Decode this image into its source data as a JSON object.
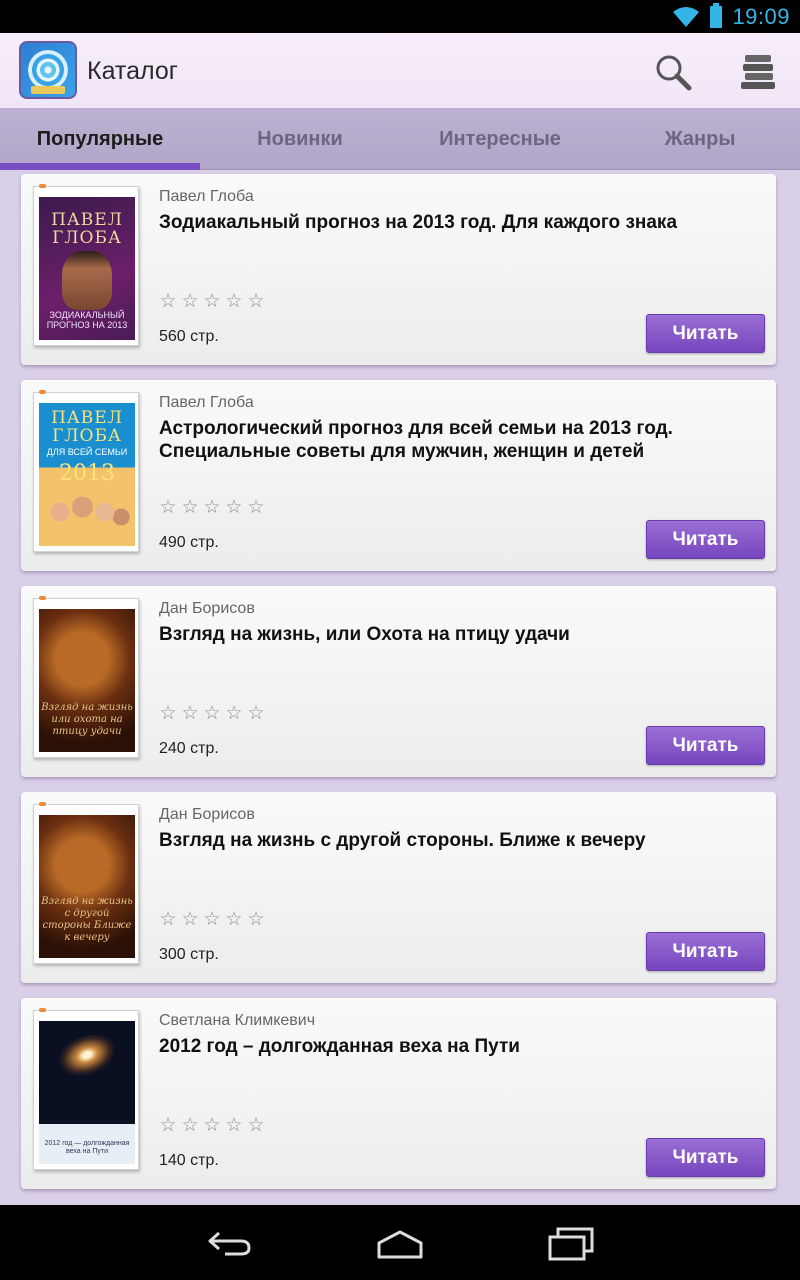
{
  "status_bar": {
    "time": "19:09"
  },
  "action_bar": {
    "title": "Каталог"
  },
  "tabs": [
    {
      "label": "Популярные",
      "active": true
    },
    {
      "label": "Новинки",
      "active": false
    },
    {
      "label": "Интересные",
      "active": false
    },
    {
      "label": "Жанры",
      "active": false
    }
  ],
  "books": [
    {
      "author": "Павел Глоба",
      "title": "Зодиакальный прогноз на 2013 год. Для каждого знака",
      "pages": "560 стр.",
      "rating": 0,
      "button": "Читать",
      "cover": {
        "line1": "ПАВЕЛ",
        "line2": "ГЛОБА",
        "sub": "ЗОДИАКАЛЬНЫЙ ПРОГНОЗ НА 2013"
      }
    },
    {
      "author": "Павел Глоба",
      "title": "Астрологический прогноз для всей семьи на 2013 год. Специальные советы для мужчин, женщин и детей",
      "pages": "490 стр.",
      "rating": 0,
      "button": "Читать",
      "cover": {
        "line1": "ПАВЕЛ",
        "line2": "ГЛОБА",
        "sub": "ДЛЯ ВСЕЙ СЕМЬИ",
        "year": "2013"
      }
    },
    {
      "author": "Дан Борисов",
      "title": "Взгляд на жизнь, или Охота на птицу удачи",
      "pages": "240 стр.",
      "rating": 0,
      "button": "Читать",
      "cover": {
        "sub": "Взгляд на жизнь или охота на птицу удачи"
      }
    },
    {
      "author": "Дан Борисов",
      "title": "Взгляд на жизнь с другой стороны. Ближе к вечеру",
      "pages": "300 стр.",
      "rating": 0,
      "button": "Читать",
      "cover": {
        "sub": "Взгляд на жизнь с другой стороны Ближе к вечеру"
      }
    },
    {
      "author": "Светлана Климкевич",
      "title": "2012 год – долгожданная веха на Пути",
      "pages": "140 стр.",
      "rating": 0,
      "button": "Читать",
      "cover": {
        "sub": "2012 год — долгожданная веха на Пути"
      }
    }
  ],
  "stars": [
    "☆",
    "☆",
    "☆",
    "☆",
    "☆"
  ],
  "colors": {
    "accent": "#7a4fc4",
    "button": "#8a5bcc",
    "status_text": "#33b5e5",
    "background": "#e3dbee"
  },
  "icons": {
    "app": "spiral-app-icon",
    "search": "search-icon",
    "library": "library-icon",
    "back": "back-icon",
    "home": "home-icon",
    "recents": "recents-icon"
  }
}
